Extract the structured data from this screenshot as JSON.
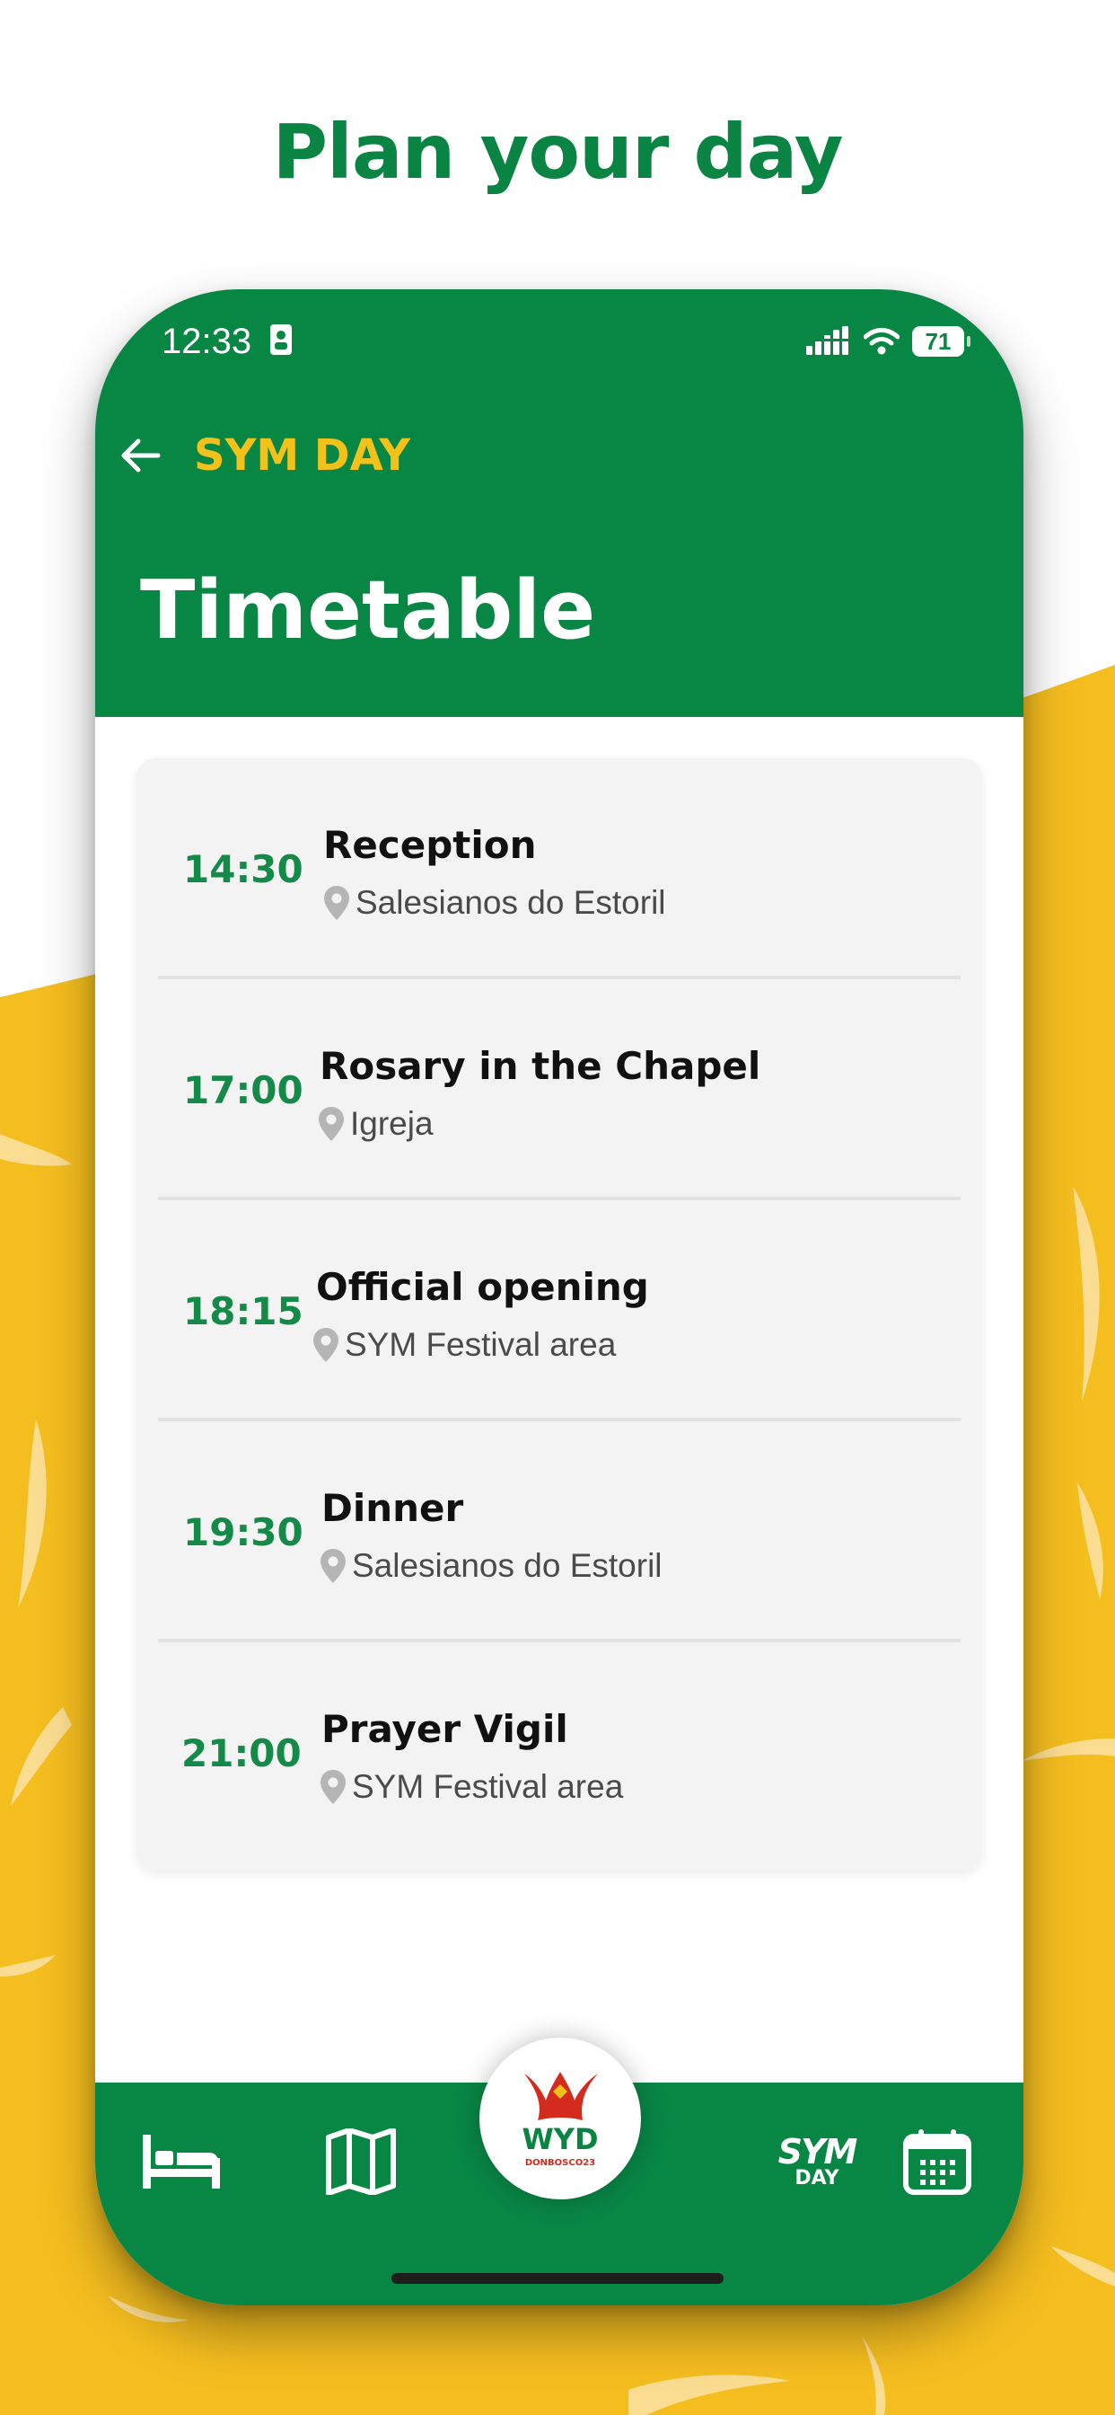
{
  "promo": {
    "headline": "Plan your day"
  },
  "status_bar": {
    "time": "12:33",
    "battery": "71"
  },
  "nav": {
    "title": "SYM DAY"
  },
  "page": {
    "title": "Timetable"
  },
  "timetable": [
    {
      "time": "14:30",
      "name": "Reception",
      "place": "Salesianos do Estoril"
    },
    {
      "time": "17:00",
      "name": "Rosary in the Chapel",
      "place": "Igreja"
    },
    {
      "time": "18:15",
      "name": "Official opening",
      "place": "SYM Festival area"
    },
    {
      "time": "19:30",
      "name": "Dinner",
      "place": "Salesianos do Estoril"
    },
    {
      "time": "21:00",
      "name": "Prayer Vigil",
      "place": "SYM Festival area"
    }
  ],
  "bottom_nav": {
    "tabs": [
      {
        "icon": "bed-icon"
      },
      {
        "icon": "map-icon"
      },
      {
        "icon": "wyd-logo"
      },
      {
        "icon": "sym-day-logo"
      },
      {
        "icon": "calendar-icon"
      }
    ],
    "wyd_logo_text": "WYD",
    "wyd_logo_sub": "DONBOSCO23",
    "sym_logo_top": "SYM",
    "sym_logo_bottom": "DAY"
  },
  "colors": {
    "brand_green": "#088644",
    "accent_yellow": "#f2c21b",
    "background_yellow": "#f5be1f"
  }
}
